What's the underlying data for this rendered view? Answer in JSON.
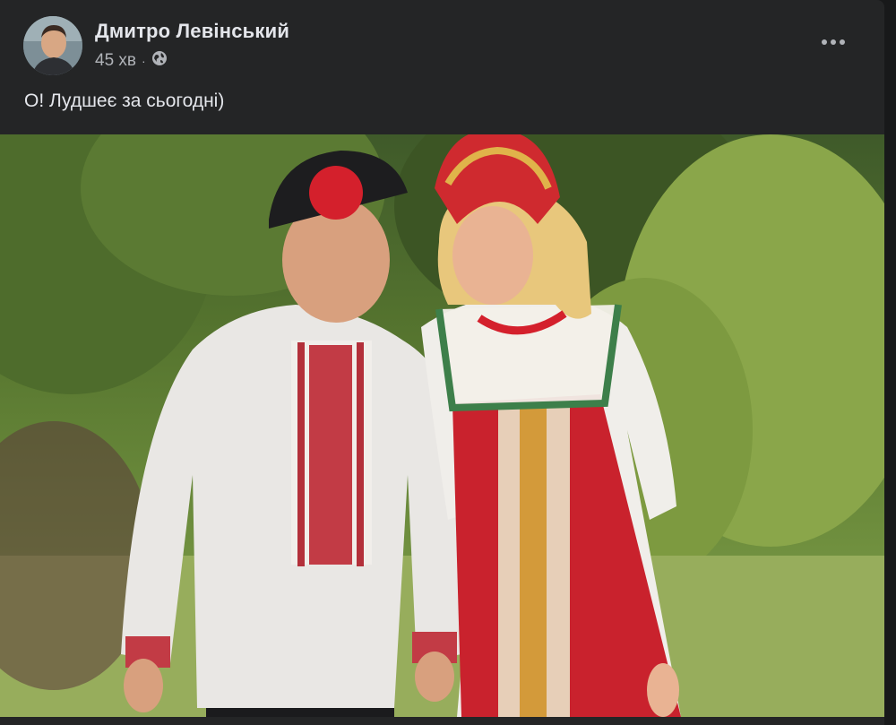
{
  "post": {
    "author_name": "Дмитро Левінський",
    "timestamp": "45 хв",
    "privacy_icon": "globe-icon",
    "more_icon": "more-horizontal-icon",
    "text": "О! Лудшеє за сьогодні)"
  },
  "colors": {
    "card_bg": "#242526",
    "page_bg": "#18191a",
    "primary_text": "#e4e6eb",
    "secondary_text": "#b0b3b8"
  }
}
